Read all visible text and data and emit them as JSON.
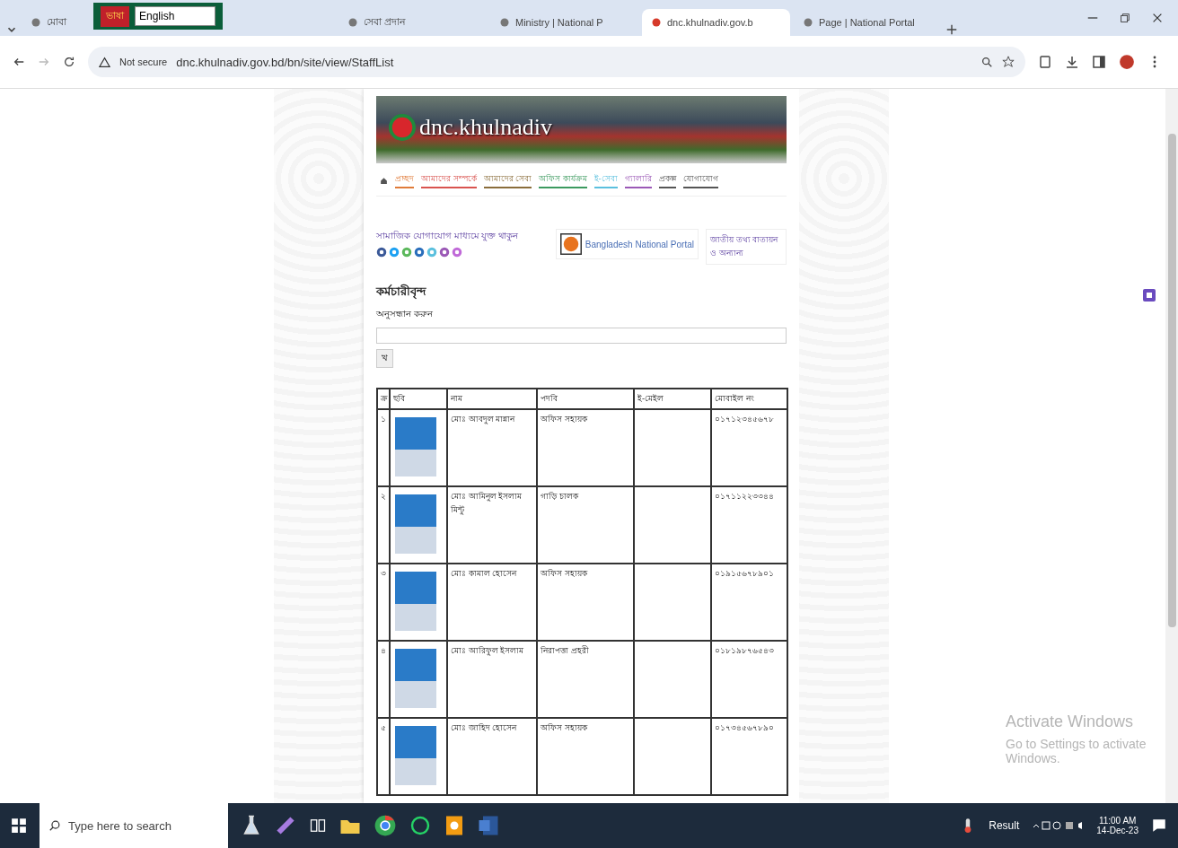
{
  "browser": {
    "tabs": [
      {
        "title": "মোবা",
        "selected": false
      },
      {
        "title": "সেবা প্রদান",
        "selected": false
      },
      {
        "title": "Ministry | National P",
        "selected": false
      },
      {
        "title": "dnc.khulnadiv.gov.b",
        "selected": true
      },
      {
        "title": "Page | National Portal",
        "selected": false
      }
    ],
    "language_widget": {
      "label": "ভাষা",
      "value": "English"
    },
    "address": {
      "security": "Not secure",
      "url": "dnc.khulnadiv.gov.bd/bn/site/view/StaffList"
    }
  },
  "site": {
    "logo_text": "dnc.khulnadiv",
    "menu": [
      {
        "label": "প্রচ্ছদ",
        "color": "#e07b39"
      },
      {
        "label": "আমাদের সম্পর্কে",
        "color": "#d9534f"
      },
      {
        "label": "আমাদের সেবা",
        "color": "#8a6d3b"
      },
      {
        "label": "অফিস কার্যক্রম",
        "color": "#3c9a5f"
      },
      {
        "label": "ই-সেবা",
        "color": "#5bc0de"
      },
      {
        "label": "গ্যালারি",
        "color": "#9b59b6"
      },
      {
        "label": "প্রকল্প",
        "color": "#555555"
      },
      {
        "label": "যোগাযোগ",
        "color": "#555555"
      }
    ],
    "social_label": "সামাজিক যোগাযোগ মাধ্যমে যুক্ত থাকুন",
    "social_icons": [
      {
        "color": "#3b5998"
      },
      {
        "color": "#1da1f2"
      },
      {
        "color": "#5cb85c"
      },
      {
        "color": "#2a6ebb"
      },
      {
        "color": "#5bc0de"
      },
      {
        "color": "#9b59b6"
      },
      {
        "color": "#c06ad8"
      }
    ],
    "portal_title": "Bangladesh National Portal",
    "side_link": "জাতীয় তথ্য বাতায়ন ও অন্যান্য",
    "heading": "কর্মচারীবৃন্দ",
    "search_label": "অনুসন্ধান করুন",
    "search_button": "খ",
    "table": {
      "columns": [
        "ক্র",
        "ছবি",
        "নাম",
        "পদবি",
        "ই-মেইল",
        "মোবাইল নং"
      ],
      "rows": [
        {
          "sl": "১",
          "name": "মোঃ আবদুল মান্নান",
          "designation": "অফিস সহায়ক",
          "email": "",
          "mobile": "০১৭১২৩৪৫৬৭৮"
        },
        {
          "sl": "২",
          "name": "মোঃ আমিনুল ইসলাম মিন্টু",
          "designation": "গাড়ি চালক",
          "email": "",
          "mobile": "০১৭১১২২৩৩৪৪"
        },
        {
          "sl": "৩",
          "name": "মোঃ কামাল হোসেন",
          "designation": "অফিস সহায়ক",
          "email": "",
          "mobile": "০১৯১৫৬৭৮৯০১"
        },
        {
          "sl": "৪",
          "name": "মোঃ আরিফুল ইসলাম",
          "designation": "নিরাপত্তা প্রহরী",
          "email": "",
          "mobile": "০১৮১৯৮৭৬৫৪৩"
        },
        {
          "sl": "৫",
          "name": "মোঃ জাহিদ হোসেন",
          "designation": "অফিস সহায়ক",
          "email": "",
          "mobile": "০১৭৩৪৫৬৭৮৯০"
        }
      ]
    }
  },
  "watermark_os": {
    "title": "Activate Windows",
    "subtitle": "Go to Settings to activate Windows."
  },
  "taskbar": {
    "search_placeholder": "Type here to search",
    "result_label": "Result",
    "time": "11:00 AM",
    "date": "14-Dec-23"
  }
}
